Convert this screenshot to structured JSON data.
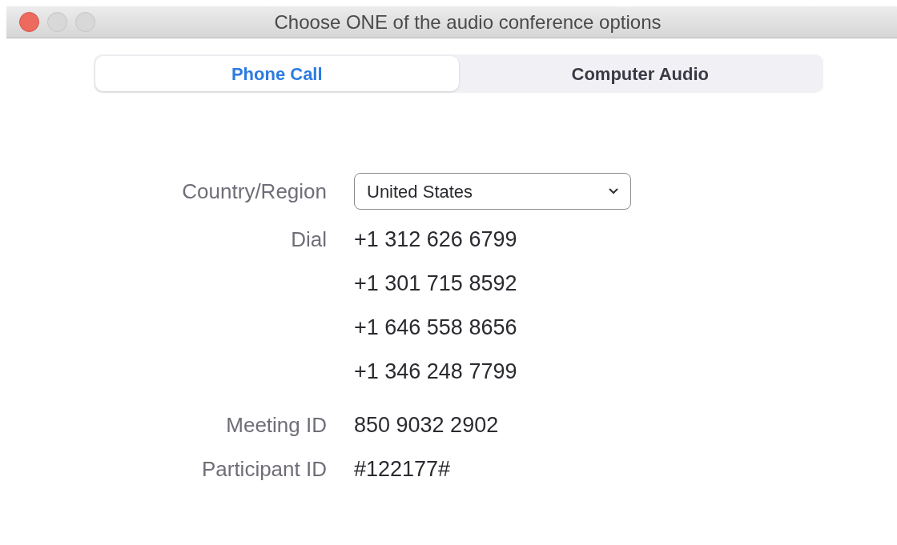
{
  "window": {
    "title": "Choose ONE of the audio conference options"
  },
  "tabs": [
    {
      "label": "Phone Call",
      "selected": true
    },
    {
      "label": "Computer Audio",
      "selected": false
    }
  ],
  "form": {
    "country_label": "Country/Region",
    "country_value": "United States",
    "dial_label": "Dial",
    "dial_numbers": [
      "+1 312 626 6799",
      "+1 301 715 8592",
      "+1 646 558 8656",
      "+1 346 248 7799"
    ],
    "meeting_id_label": "Meeting ID",
    "meeting_id": "850 9032 2902",
    "participant_id_label": "Participant ID",
    "participant_id": "#122177#"
  }
}
